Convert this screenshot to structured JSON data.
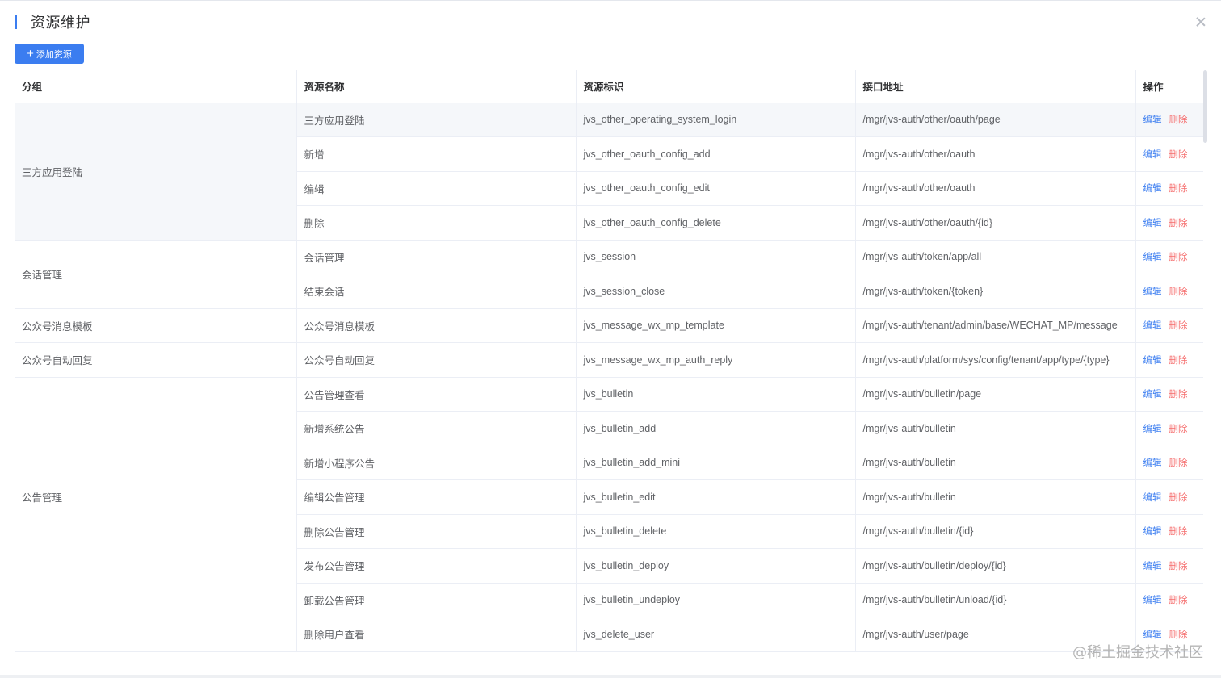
{
  "header": {
    "title": "资源维护"
  },
  "toolbar": {
    "add_label": "添加资源",
    "add_icon": "plus-icon"
  },
  "colors": {
    "accent": "#3b7df0",
    "danger": "#f56c6c",
    "header_text": "#303133",
    "body_text": "#606266"
  },
  "table": {
    "columns": [
      "分组",
      "资源名称",
      "资源标识",
      "接口地址",
      "操作"
    ],
    "edit_label": "编辑",
    "delete_label": "删除",
    "groups": [
      {
        "name": "三方应用登陆",
        "rows": [
          {
            "name": "三方应用登陆",
            "code": "jvs_other_operating_system_login",
            "url": "/mgr/jvs-auth/other/oauth/page"
          },
          {
            "name": "新增",
            "code": "jvs_other_oauth_config_add",
            "url": "/mgr/jvs-auth/other/oauth"
          },
          {
            "name": "编辑",
            "code": "jvs_other_oauth_config_edit",
            "url": "/mgr/jvs-auth/other/oauth"
          },
          {
            "name": "删除",
            "code": "jvs_other_oauth_config_delete",
            "url": "/mgr/jvs-auth/other/oauth/{id}"
          }
        ]
      },
      {
        "name": "会话管理",
        "rows": [
          {
            "name": "会话管理",
            "code": "jvs_session",
            "url": "/mgr/jvs-auth/token/app/all"
          },
          {
            "name": "结束会话",
            "code": "jvs_session_close",
            "url": "/mgr/jvs-auth/token/{token}"
          }
        ]
      },
      {
        "name": "公众号消息模板",
        "rows": [
          {
            "name": "公众号消息模板",
            "code": "jvs_message_wx_mp_template",
            "url": "/mgr/jvs-auth/tenant/admin/base/WECHAT_MP/message"
          }
        ]
      },
      {
        "name": "公众号自动回复",
        "rows": [
          {
            "name": "公众号自动回复",
            "code": "jvs_message_wx_mp_auth_reply",
            "url": "/mgr/jvs-auth/platform/sys/config/tenant/app/type/{type}"
          }
        ]
      },
      {
        "name": "公告管理",
        "rows": [
          {
            "name": "公告管理查看",
            "code": "jvs_bulletin",
            "url": "/mgr/jvs-auth/bulletin/page"
          },
          {
            "name": "新增系统公告",
            "code": "jvs_bulletin_add",
            "url": "/mgr/jvs-auth/bulletin"
          },
          {
            "name": "新增小程序公告",
            "code": "jvs_bulletin_add_mini",
            "url": "/mgr/jvs-auth/bulletin"
          },
          {
            "name": "编辑公告管理",
            "code": "jvs_bulletin_edit",
            "url": "/mgr/jvs-auth/bulletin"
          },
          {
            "name": "删除公告管理",
            "code": "jvs_bulletin_delete",
            "url": "/mgr/jvs-auth/bulletin/{id}"
          },
          {
            "name": "发布公告管理",
            "code": "jvs_bulletin_deploy",
            "url": "/mgr/jvs-auth/bulletin/deploy/{id}"
          },
          {
            "name": "卸载公告管理",
            "code": "jvs_bulletin_undeploy",
            "url": "/mgr/jvs-auth/bulletin/unload/{id}"
          }
        ]
      },
      {
        "name": "",
        "rows": [
          {
            "name": "删除用户查看",
            "code": "jvs_delete_user",
            "url": "/mgr/jvs-auth/user/page"
          }
        ]
      }
    ]
  },
  "watermark": "@稀土掘金技术社区"
}
